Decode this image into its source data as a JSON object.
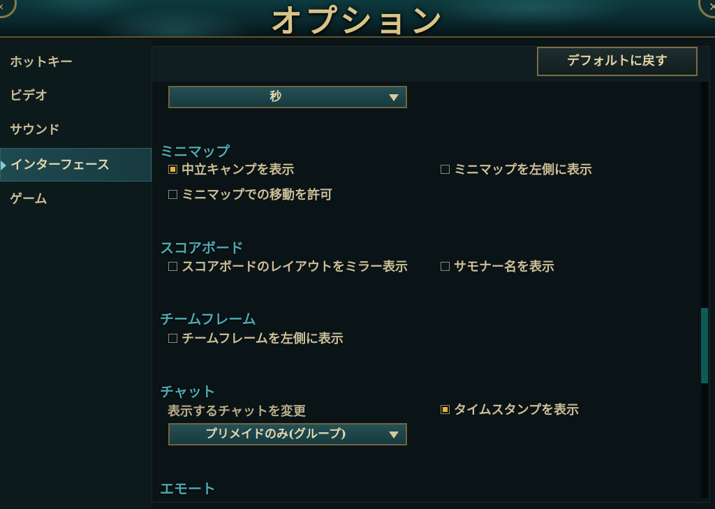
{
  "header": {
    "title": "オプション"
  },
  "sidebar": {
    "items": [
      {
        "label": "ホットキー"
      },
      {
        "label": "ビデオ"
      },
      {
        "label": "サウンド"
      },
      {
        "label": "インターフェース"
      },
      {
        "label": "ゲーム"
      }
    ]
  },
  "toolbar": {
    "default_label": "デフォルトに戻す"
  },
  "timer_dropdown": {
    "value": "秒"
  },
  "minimap": {
    "title": "ミニマップ",
    "options": [
      {
        "label": "中立キャンプを表示",
        "checked": true
      },
      {
        "label": "ミニマップを左側に表示",
        "checked": false
      },
      {
        "label": "ミニマップでの移動を許可",
        "checked": false
      }
    ]
  },
  "scoreboard": {
    "title": "スコアボード",
    "options": [
      {
        "label": "スコアボードのレイアウトをミラー表示",
        "checked": false
      },
      {
        "label": "サモナー名を表示",
        "checked": false
      }
    ]
  },
  "teamframe": {
    "title": "チームフレーム",
    "options": [
      {
        "label": "チームフレームを左側に表示",
        "checked": false
      }
    ]
  },
  "chat": {
    "title": "チャット",
    "change_label": "表示するチャットを変更",
    "dropdown_value": "プリメイドのみ(グループ)",
    "options": [
      {
        "label": "タイムスタンプを表示",
        "checked": true
      }
    ]
  },
  "emote": {
    "title": "エモート"
  },
  "colors": {
    "accent": "#4fa8b0",
    "gold": "#d9c487",
    "checkbox_checked": "#e2b53a"
  }
}
